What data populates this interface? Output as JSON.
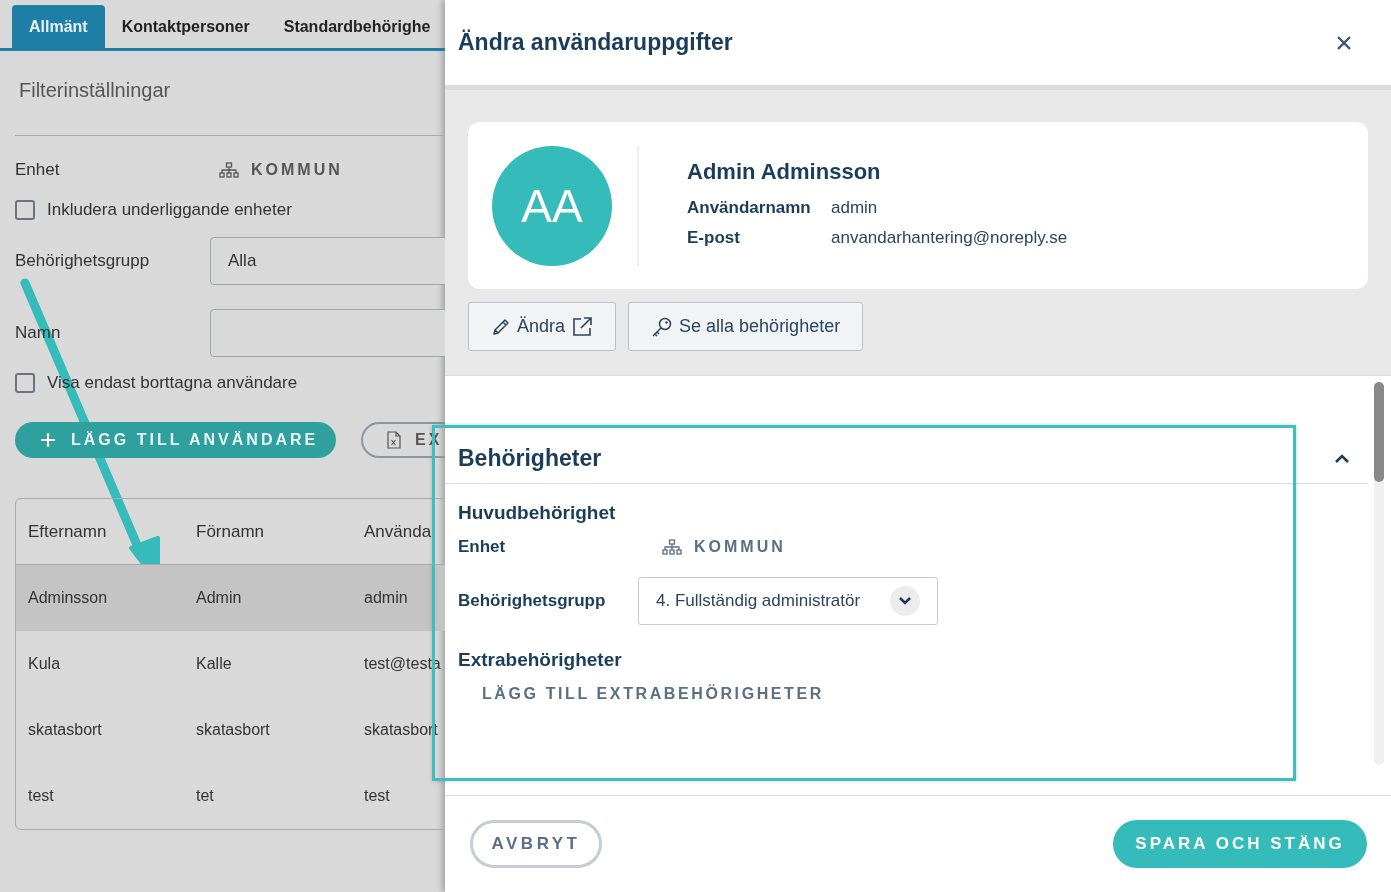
{
  "tabs": [
    {
      "label": "Allmänt",
      "selected": true
    },
    {
      "label": "Kontaktpersoner",
      "selected": false
    },
    {
      "label": "Standardbehörighe",
      "selected": false
    }
  ],
  "filter": {
    "title": "Filterinställningar",
    "unit_label": "Enhet",
    "unit_value": "KOMMUN",
    "include_sub": {
      "label": "Inkludera underliggande enheter",
      "checked": false
    },
    "group_label": "Behörighetsgrupp",
    "group_value": "Alla",
    "name_label": "Namn",
    "deleted_only": {
      "label": "Visa endast borttagna användare",
      "checked": false
    }
  },
  "actions": {
    "add": "LÄGG TILL ANVÄNDARE",
    "export": "EX"
  },
  "table": {
    "columns": [
      "Efternamn",
      "Förnamn",
      "Använda"
    ],
    "rows": [
      {
        "cells": [
          "Adminsson",
          "Admin",
          "admin"
        ],
        "selected": true
      },
      {
        "cells": [
          "Kula",
          "Kalle",
          "test@testa"
        ],
        "selected": false
      },
      {
        "cells": [
          "skatasbort",
          "skatasbort",
          "skatasbort"
        ],
        "selected": false
      },
      {
        "cells": [
          "test",
          "tet",
          "test"
        ],
        "selected": false
      }
    ]
  },
  "dialog": {
    "title": "Ändra användaruppgifter",
    "user": {
      "initials": "AA",
      "name": "Admin Adminsson",
      "fields": [
        {
          "label": "Användarnamn",
          "value": "admin"
        },
        {
          "label": "E-post",
          "value": "anvandarhantering@noreply.se"
        }
      ]
    },
    "buttons": [
      "Ändra",
      "Se alla behörigheter"
    ],
    "section": {
      "title": "Behörigheter",
      "expanded": true,
      "main_title": "Huvudbehörighet",
      "unit_label": "Enhet",
      "unit_value": "KOMMUN",
      "group_label": "Behörighetsgrupp",
      "group_value": "4. Fullständig administratör",
      "extra_title": "Extrabehörigheter",
      "extra_link": "LÄGG TILL EXTRABEHÖRIGHETER"
    },
    "footer": {
      "cancel": "AVBRYT",
      "save": "SPARA OCH STÄNG"
    }
  }
}
